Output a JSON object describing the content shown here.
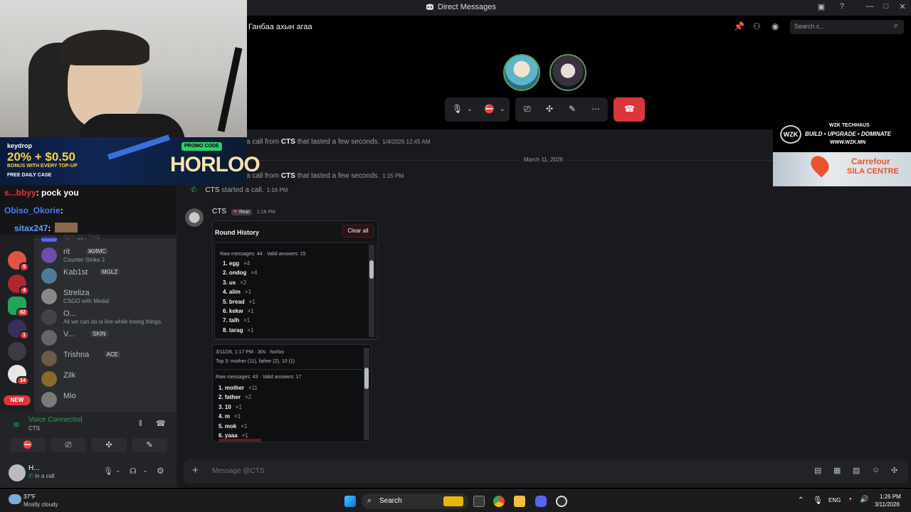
{
  "window": {
    "title": "Direct Messages"
  },
  "header": {
    "channel_name": "Ганбаа ахын агаа",
    "search_placeholder": "Search c..."
  },
  "calls": {
    "msg1": {
      "pre": "a call from",
      "user": "CTS",
      "post": "that lasted a few seconds.",
      "time": "1/4/2026 12:45 AM"
    },
    "date_divider": "March 11, 2026",
    "msg2": {
      "pre": "a call from",
      "user": "CTS",
      "post": "that lasted a few seconds.",
      "time": "1:15 PM"
    },
    "msg3": {
      "user": "CTS",
      "post": "started a call.",
      "time": "1:16 PM"
    }
  },
  "bot_message": {
    "author": "CTS",
    "role_tag": "Янаг",
    "time": "1:18 PM",
    "panel_title": "Round History",
    "clear_label": "Clear all",
    "round1": {
      "stats": "Raw messages: 44 · Valid answers: 15",
      "answers": [
        {
          "word": "1. egg",
          "count": "×4"
        },
        {
          "word": "2. ondog",
          "count": "×4"
        },
        {
          "word": "3. us",
          "count": "×2"
        },
        {
          "word": "4. alim",
          "count": "×1"
        },
        {
          "word": "5. bread",
          "count": "×1"
        },
        {
          "word": "6. kekw",
          "count": "×1"
        },
        {
          "word": "7. talh",
          "count": "×1"
        },
        {
          "word": "8. tarag",
          "count": "×1"
        }
      ]
    },
    "round2": {
      "header": "3/11/26, 1:17 PM · 30s · horloo",
      "top3": "Top 3: mother (11), father (2), 10 (1)",
      "stats": "Raw messages: 43 · Valid answers: 17",
      "answers": [
        {
          "word": "1. mother",
          "count": "×11"
        },
        {
          "word": "2. father",
          "count": "×2"
        },
        {
          "word": "3. 10",
          "count": "×1"
        },
        {
          "word": "4. m",
          "count": "×1"
        },
        {
          "word": "5. mok",
          "count": "×1"
        },
        {
          "word": "6. yaaa",
          "count": "×1"
        }
      ]
    }
  },
  "dm_list": [
    {
      "name": "",
      "sub": "dyno.gg | !help",
      "tag": ""
    },
    {
      "name": "rit",
      "sub": "Counter-Strike 2",
      "tag": "ЖИМС"
    },
    {
      "name": "Kab1st",
      "sub": "",
      "tag": "MGLZ"
    },
    {
      "name": "Streliza",
      "sub": "CSGO with Medal",
      "tag": ""
    },
    {
      "name": "O...",
      "sub": "All we can do is live while losing things.",
      "tag": ""
    },
    {
      "name": "V...",
      "sub": "",
      "tag": "SKIN"
    },
    {
      "name": "Trishna",
      "sub": "",
      "tag": "ACE"
    },
    {
      "name": "Zilk",
      "sub": "",
      "tag": ""
    },
    {
      "name": "Mio",
      "sub": "",
      "tag": ""
    }
  ],
  "server_badges": [
    "5",
    "4",
    "62",
    "1",
    "14"
  ],
  "new_badge": "NEW",
  "voice": {
    "status": "Voice Connected",
    "channel": "CTS"
  },
  "user": {
    "name": "H...",
    "status": "In a call"
  },
  "input": {
    "placeholder": "Message @CTS"
  },
  "stream_chat": [
    {
      "user": "s...bbyy",
      "msg": ": pock you"
    },
    {
      "user": "Obiso_Okorie",
      "msg": ":"
    },
    {
      "user": "sitax247",
      "msg": ":"
    }
  ],
  "promo": {
    "brand": "keydrop",
    "offer": "20% + $0.50",
    "offer_sub": "BONUS WITH EVERY TOP-UP",
    "daily": "FREE DAILY CASE",
    "code_label": "PROMO CODE",
    "code": "HORLOO"
  },
  "sponsor": {
    "logo": "WZK",
    "line1": "WZK TECHHAUS",
    "line2": "BUILD • UPGRADE • DOMINATE",
    "line3": "WWW.WZK.MN",
    "carrefour1": "Carrefour",
    "carrefour2": "SILA CENTRE"
  },
  "taskbar": {
    "weather_temp": "37°F",
    "weather_desc": "Mostly cloudy",
    "search": "Search",
    "lang": "ENG",
    "time": "1:26 PM",
    "date": "3/11/2026"
  },
  "colors": {
    "accent": "#5865f2",
    "danger": "#da373c",
    "green": "#23a55a"
  }
}
